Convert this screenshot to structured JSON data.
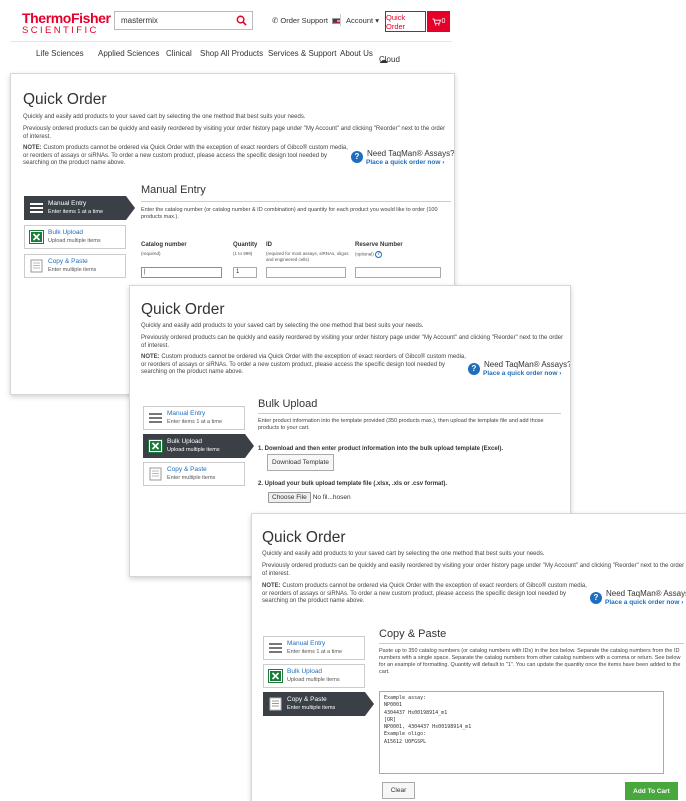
{
  "header": {
    "logo_line1": "ThermoFisher",
    "logo_line2": "SCIENTIFIC",
    "search_value": "mastermix",
    "order_support": "Order Support",
    "account": "Account",
    "quick_order": "Quick Order",
    "cart_count": "0",
    "nav": [
      "Life Sciences",
      "Applied Sciences",
      "Clinical",
      "Shop All Products",
      "Services & Support",
      "About Us",
      "Cloud"
    ]
  },
  "page": {
    "title": "Quick Order",
    "intro": "Quickly and easily add products to your saved cart by selecting the one method that best suits your needs.",
    "previously": "Previously ordered products can be quickly and easily reordered by visiting your order history page under \"My Account\" and clicking \"Reorder\" next to the order of interest.",
    "note_label": "NOTE:",
    "note_text": " Custom products cannot be ordered via Quick Order with the exception of exact reorders of Gibco® custom media, or reorders of assays or siRNAs. To order a new custom product, please access the specific design tool needed by searching on the product name above.",
    "taqman_line1": "Need TaqMan® Assays?",
    "taqman_line2": "Place a quick order now ›"
  },
  "sidebar": [
    {
      "label": "Manual Entry",
      "sub": "Enter items 1 at a time"
    },
    {
      "label": "Bulk Upload",
      "sub": "Upload multiple items"
    },
    {
      "label": "Copy & Paste",
      "sub": "Enter multiple items"
    }
  ],
  "manual": {
    "title": "Manual Entry",
    "desc": "Enter the catalog number (or catalog number & ID combination) and quantity for each product you would like to order (100 products max.).",
    "catalog_label": "Catalog number",
    "catalog_sub": "(required)",
    "qty_label": "Quantity",
    "qty_sub": "(1 to 999)",
    "qty_value": "1",
    "id_label": "ID",
    "id_sub": "(required for most assays, siRNAs, oligos and engineered cells)",
    "reserve_label": "Reserve Number",
    "reserve_sub": "(optional)"
  },
  "bulk": {
    "title": "Bulk Upload",
    "desc": "Enter product information into the template provided (350 products max.), then upload the template file and add those products to your cart.",
    "step1": "1.  Download and then enter product information into the bulk upload template (Excel).",
    "download_btn": "Download Template",
    "step2": "2.  Upload your bulk upload template file (.xlsx, .xls or .csv format).",
    "choose_file": "Choose File",
    "file_status": "No fil...hosen"
  },
  "copy": {
    "title": "Copy & Paste",
    "desc": "Paste up to 350 catalog numbers (or catalog numbers with IDs) in the box below. Separate the catalog numbers from the ID numbers with a single space. Separate the catalog numbers from other catalog numbers with a comma or return. See below for an example of formatting. Quantity will default to \"1\". You can update the quantity once the items have been added to the cart.",
    "example_lines": [
      "Example assay:",
      "NP0001",
      "4304437 Hs00198914_m1",
      "[OR]",
      "NP0001, 4304437 Hs00198914_m1",
      "Example oligo:",
      "A15612 U0FGSPL"
    ],
    "clear_btn": "Clear",
    "add_btn": "Add To Cart"
  },
  "colors": {
    "brand_red": "#e4002b",
    "link_blue": "#1f6dbd",
    "active_dark": "#3b3f46",
    "add_green": "#49a83d"
  }
}
